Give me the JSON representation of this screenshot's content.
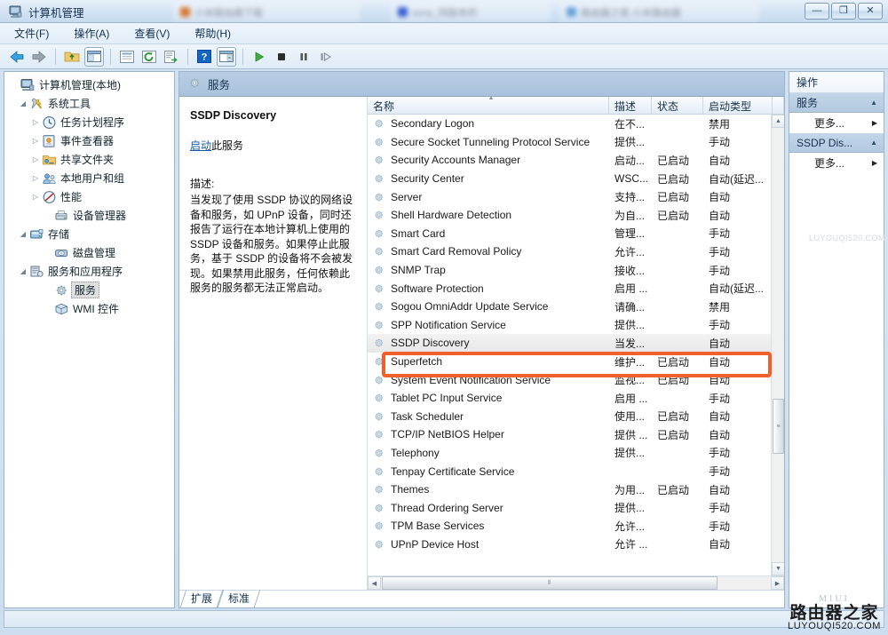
{
  "window": {
    "title": "计算机管理",
    "title_icon": "computer-management-icon",
    "ghost_tabs": [
      {
        "label": "小米路由器下载",
        "color": "#d9752f"
      },
      {
        "label": "sony_同版本的",
        "color": "#3b5fd0"
      },
      {
        "label": "路由器之家,小米路由器",
        "color": "#6aa2d8"
      }
    ],
    "controls": {
      "minimize": "—",
      "maximize": "❐",
      "close": "✕"
    }
  },
  "menubar": {
    "items": [
      {
        "label": "文件(F)"
      },
      {
        "label": "操作(A)"
      },
      {
        "label": "查看(V)"
      },
      {
        "label": "帮助(H)"
      }
    ]
  },
  "toolbar": {
    "buttons": [
      {
        "name": "back-icon",
        "glyph": "←"
      },
      {
        "name": "forward-icon",
        "glyph": "→"
      },
      {
        "name": "up-folder-icon",
        "glyph": "📁"
      },
      {
        "name": "show-tree-icon",
        "glyph": "▤"
      },
      {
        "name": "properties-icon",
        "glyph": "▤"
      },
      {
        "name": "refresh-icon",
        "glyph": "↻"
      },
      {
        "name": "export-list-icon",
        "glyph": "⇥"
      },
      {
        "name": "help-icon",
        "glyph": "?"
      },
      {
        "name": "show-action-pane-icon",
        "glyph": "▥"
      },
      {
        "name": "start-service-icon",
        "glyph": "▶"
      },
      {
        "name": "stop-service-icon",
        "glyph": "■"
      },
      {
        "name": "pause-service-icon",
        "glyph": "❚❚"
      },
      {
        "name": "restart-service-icon",
        "glyph": "❚▶"
      }
    ]
  },
  "tree": {
    "nodes": [
      {
        "label": "计算机管理(本地)",
        "indent": 0,
        "arrow": "",
        "icon": "computer-icon",
        "selected": false
      },
      {
        "label": "系统工具",
        "indent": 1,
        "arrow": "◢",
        "icon": "tools-icon",
        "selected": false
      },
      {
        "label": "任务计划程序",
        "indent": 2,
        "arrow": "▷",
        "icon": "clock-icon",
        "selected": false
      },
      {
        "label": "事件查看器",
        "indent": 2,
        "arrow": "▷",
        "icon": "eventviewer-icon",
        "selected": false
      },
      {
        "label": "共享文件夹",
        "indent": 2,
        "arrow": "▷",
        "icon": "sharedfolder-icon",
        "selected": false
      },
      {
        "label": "本地用户和组",
        "indent": 2,
        "arrow": "▷",
        "icon": "users-icon",
        "selected": false
      },
      {
        "label": "性能",
        "indent": 2,
        "arrow": "▷",
        "icon": "performance-icon",
        "selected": false
      },
      {
        "label": "设备管理器",
        "indent": 2,
        "arrow": "",
        "icon": "devicemanager-icon",
        "selected": false
      },
      {
        "label": "存储",
        "indent": 1,
        "arrow": "◢",
        "icon": "storage-icon",
        "selected": false
      },
      {
        "label": "磁盘管理",
        "indent": 2,
        "arrow": "",
        "icon": "disk-icon",
        "selected": false
      },
      {
        "label": "服务和应用程序",
        "indent": 1,
        "arrow": "◢",
        "icon": "servicesapps-icon",
        "selected": false
      },
      {
        "label": "服务",
        "indent": 2,
        "arrow": "",
        "icon": "gear-icon",
        "selected": true
      },
      {
        "label": "WMI 控件",
        "indent": 2,
        "arrow": "",
        "icon": "wmi-icon",
        "selected": false
      }
    ]
  },
  "center": {
    "header": "服务",
    "header_icon": "gear-icon",
    "detail": {
      "service_name": "SSDP Discovery",
      "action_link": "启动",
      "action_suffix": "此服务",
      "desc_label": "描述:",
      "desc_body": "当发现了使用 SSDP 协议的网络设备和服务，如 UPnP 设备，同时还报告了运行在本地计算机上使用的 SSDP 设备和服务。如果停止此服务，基于 SSDP 的设备将不会被发现。如果禁用此服务，任何依赖此服务的服务都无法正常启动。"
    },
    "columns": [
      {
        "label": "名称",
        "key": "name",
        "sorted": true
      },
      {
        "label": "描述",
        "key": "desc",
        "sorted": false
      },
      {
        "label": "状态",
        "key": "state",
        "sorted": false
      },
      {
        "label": "启动类型",
        "key": "start",
        "sorted": false
      },
      {
        "label": "",
        "key": "logon",
        "sorted": false
      }
    ],
    "rows": [
      {
        "name": "Secondary Logon",
        "desc": "在不...",
        "state": "",
        "start": "禁用",
        "selected": false
      },
      {
        "name": "Secure Socket Tunneling Protocol Service",
        "desc": "提供...",
        "state": "",
        "start": "手动",
        "selected": false
      },
      {
        "name": "Security Accounts Manager",
        "desc": "启动...",
        "state": "已启动",
        "start": "自动",
        "selected": false
      },
      {
        "name": "Security Center",
        "desc": "WSC...",
        "state": "已启动",
        "start": "自动(延迟...",
        "selected": false
      },
      {
        "name": "Server",
        "desc": "支持...",
        "state": "已启动",
        "start": "自动",
        "selected": false
      },
      {
        "name": "Shell Hardware Detection",
        "desc": "为自...",
        "state": "已启动",
        "start": "自动",
        "selected": false
      },
      {
        "name": "Smart Card",
        "desc": "管理...",
        "state": "",
        "start": "手动",
        "selected": false
      },
      {
        "name": "Smart Card Removal Policy",
        "desc": "允许...",
        "state": "",
        "start": "手动",
        "selected": false
      },
      {
        "name": "SNMP Trap",
        "desc": "接收...",
        "state": "",
        "start": "手动",
        "selected": false
      },
      {
        "name": "Software Protection",
        "desc": "启用 ...",
        "state": "",
        "start": "自动(延迟...",
        "selected": false
      },
      {
        "name": "Sogou OmniAddr Update Service",
        "desc": "请确...",
        "state": "",
        "start": "禁用",
        "selected": false
      },
      {
        "name": "SPP Notification Service",
        "desc": "提供...",
        "state": "",
        "start": "手动",
        "selected": false
      },
      {
        "name": "SSDP Discovery",
        "desc": "当发...",
        "state": "",
        "start": "自动",
        "selected": true
      },
      {
        "name": "Superfetch",
        "desc": "维护...",
        "state": "已启动",
        "start": "自动",
        "selected": false
      },
      {
        "name": "System Event Notification Service",
        "desc": "监视...",
        "state": "已启动",
        "start": "自动",
        "selected": false
      },
      {
        "name": "Tablet PC Input Service",
        "desc": "启用 ...",
        "state": "",
        "start": "手动",
        "selected": false
      },
      {
        "name": "Task Scheduler",
        "desc": "使用...",
        "state": "已启动",
        "start": "自动",
        "selected": false
      },
      {
        "name": "TCP/IP NetBIOS Helper",
        "desc": "提供 ...",
        "state": "已启动",
        "start": "自动",
        "selected": false
      },
      {
        "name": "Telephony",
        "desc": "提供...",
        "state": "",
        "start": "手动",
        "selected": false
      },
      {
        "name": "Tenpay Certificate Service",
        "desc": "",
        "state": "",
        "start": "手动",
        "selected": false
      },
      {
        "name": "Themes",
        "desc": "为用...",
        "state": "已启动",
        "start": "自动",
        "selected": false
      },
      {
        "name": "Thread Ordering Server",
        "desc": "提供...",
        "state": "",
        "start": "手动",
        "selected": false
      },
      {
        "name": "TPM Base Services",
        "desc": "允许...",
        "state": "",
        "start": "手动",
        "selected": false
      },
      {
        "name": "UPnP Device Host",
        "desc": "允许 ...",
        "state": "",
        "start": "自动",
        "selected": false
      }
    ],
    "tabs": [
      {
        "label": "扩展"
      },
      {
        "label": "标准"
      }
    ]
  },
  "actions": {
    "title": "操作",
    "groups": [
      {
        "title": "服务",
        "chevron": "▲",
        "items": [
          {
            "label": "更多...",
            "chevron": "▶"
          }
        ]
      },
      {
        "title": "SSDP Dis...",
        "chevron": "▲",
        "items": [
          {
            "label": "更多...",
            "chevron": "▶"
          }
        ]
      }
    ]
  },
  "annotation": {
    "target_row": "SSDP Discovery",
    "color": "#f0602a"
  },
  "watermark": {
    "side_text": "LUYOUQI520.COM",
    "box_top": "MIUI",
    "box_cn": "路由器之家",
    "box_en": "LUYOUQI520.COM"
  }
}
